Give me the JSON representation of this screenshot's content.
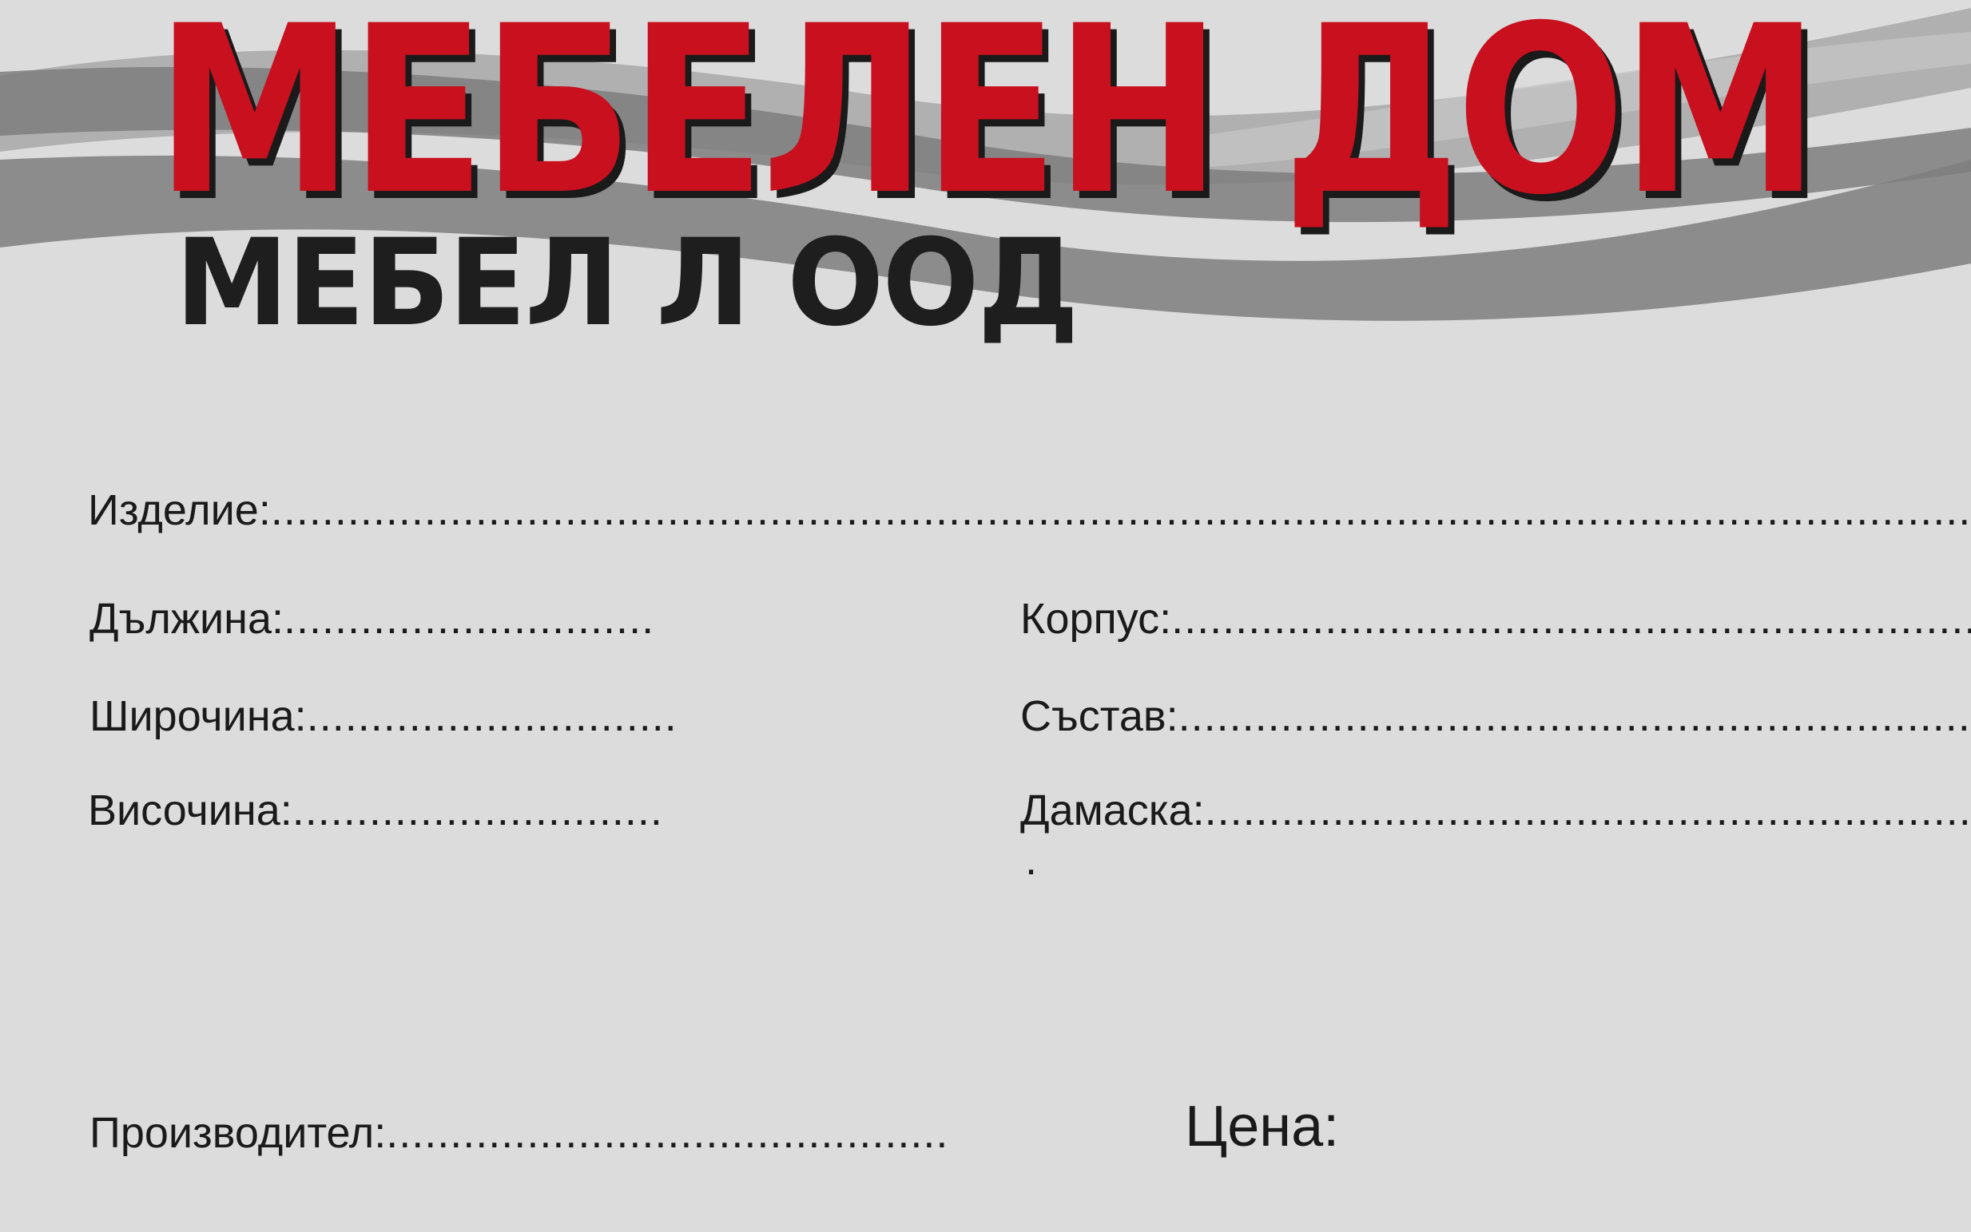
{
  "brand": {
    "title": "МЕБЕЛЕН ДОМ",
    "subtitle": "МЕБЕЛ Л ООД"
  },
  "colors": {
    "title_red": "#c8101e",
    "shadow": "#1a1a1a",
    "background": "#dcdcdc",
    "wave_dark": "#8a8a8a",
    "wave_light": "#aeaeae"
  },
  "fields": {
    "product": {
      "label": "Изделие:",
      "dots": "..................................................................................................................................................."
    },
    "length": {
      "label": "Дължина:",
      "dots": "............................."
    },
    "width": {
      "label": "Широчина:",
      "dots": "............................."
    },
    "height": {
      "label": "Височина:",
      "dots": "............................."
    },
    "body": {
      "label": "Корпус:",
      "dots": "................................................................."
    },
    "composition": {
      "label": "Състав:",
      "dots": "................................................................"
    },
    "upholstery": {
      "label": "Дамаска:",
      "dots": "............................................................",
      "extra": "."
    },
    "manufacturer": {
      "label": "Производител:",
      "dots": "............................................"
    }
  },
  "price": {
    "label": "Цена:"
  }
}
